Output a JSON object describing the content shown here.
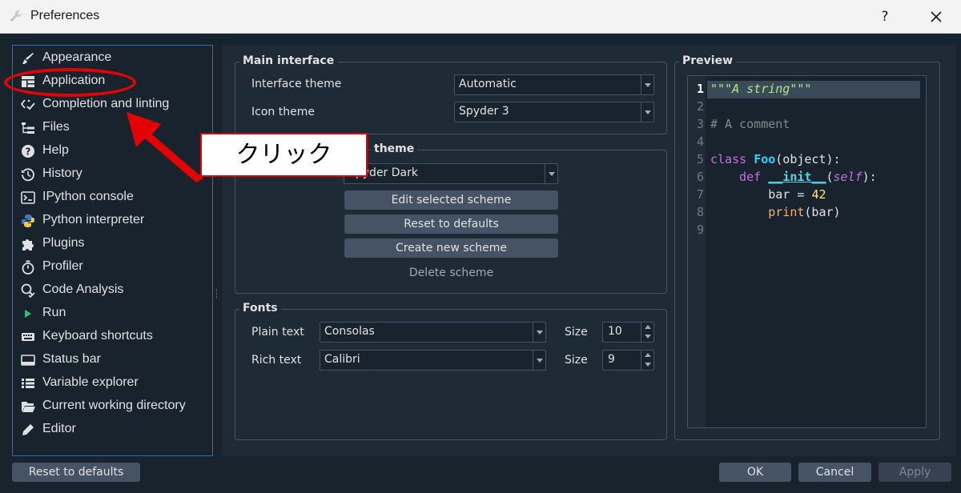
{
  "window": {
    "title": "Preferences",
    "help_label": "?"
  },
  "sidebar": {
    "items": [
      {
        "label": "Appearance",
        "icon": "brush-icon"
      },
      {
        "label": "Application",
        "icon": "layout-icon"
      },
      {
        "label": "Completion and linting",
        "icon": "lint-icon"
      },
      {
        "label": "Files",
        "icon": "files-icon"
      },
      {
        "label": "Help",
        "icon": "help-icon"
      },
      {
        "label": "History",
        "icon": "history-icon"
      },
      {
        "label": "IPython console",
        "icon": "console-icon"
      },
      {
        "label": "Python interpreter",
        "icon": "python-icon"
      },
      {
        "label": "Plugins",
        "icon": "puzzle-icon"
      },
      {
        "label": "Profiler",
        "icon": "stopwatch-icon"
      },
      {
        "label": "Code Analysis",
        "icon": "magnifier-check-icon"
      },
      {
        "label": "Run",
        "icon": "run-icon"
      },
      {
        "label": "Keyboard shortcuts",
        "icon": "keyboard-icon"
      },
      {
        "label": "Status bar",
        "icon": "statusbar-icon"
      },
      {
        "label": "Variable explorer",
        "icon": "list-icon"
      },
      {
        "label": "Current working directory",
        "icon": "folder-open-icon"
      },
      {
        "label": "Editor",
        "icon": "pencil-icon"
      }
    ]
  },
  "main_interface": {
    "title": "Main interface",
    "interface_theme_label": "Interface theme",
    "interface_theme_value": "Automatic",
    "icon_theme_label": "Icon theme",
    "icon_theme_value": "Spyder 3"
  },
  "syntax": {
    "title_visible": "theme",
    "scheme_value": "Spyder Dark",
    "edit_label": "Edit selected scheme",
    "reset_label": "Reset to defaults",
    "create_label": "Create new scheme",
    "delete_label": "Delete scheme"
  },
  "fonts": {
    "title": "Fonts",
    "plain_label": "Plain text",
    "plain_value": "Consolas",
    "rich_label": "Rich text",
    "rich_value": "Calibri",
    "size_label": "Size",
    "plain_size": "10",
    "rich_size": "9"
  },
  "preview": {
    "title": "Preview",
    "line_numbers": [
      "1",
      "2",
      "3",
      "4",
      "5",
      "6",
      "7",
      "8",
      "9"
    ],
    "code": {
      "l1": "\"\"\"A string\"\"\"",
      "l3": "# A comment",
      "l5_kw": "class",
      "l5_name": "Foo",
      "l5_rest": "(object):",
      "l6_kw": "def",
      "l6_name": "__init__",
      "l6_self": "self",
      "l7_var": "bar = ",
      "l7_num": "42",
      "l8_fn": "print",
      "l8_rest": "(bar)"
    }
  },
  "footer": {
    "reset_label": "Reset to defaults",
    "ok_label": "OK",
    "cancel_label": "Cancel",
    "apply_label": "Apply"
  },
  "annotation": {
    "text": "クリック",
    "color": "#e50000"
  },
  "colors": {
    "background": "#19232d",
    "accent": "#2c6fb6",
    "button": "#455364",
    "text": "#e0e1e3"
  }
}
